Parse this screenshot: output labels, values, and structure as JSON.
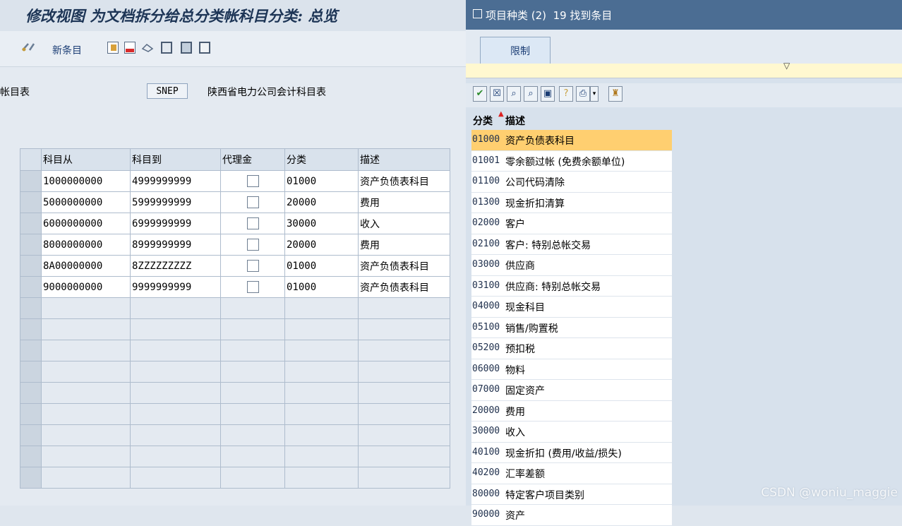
{
  "left": {
    "title": "修改视图 为文档拆分给总分类帐科目分类: 总览",
    "toolbar": {
      "new_entries": "新条目"
    },
    "field": {
      "label": "帐目表",
      "value": "SNEP",
      "description": "陕西省电力公司会计科目表"
    },
    "table": {
      "headers": [
        "科目从",
        "科目到",
        "代理金",
        "分类",
        "描述"
      ],
      "rows": [
        [
          "1000000000",
          "4999999999",
          false,
          "01000",
          "资产负债表科目"
        ],
        [
          "5000000000",
          "5999999999",
          false,
          "20000",
          "费用"
        ],
        [
          "6000000000",
          "6999999999",
          false,
          "30000",
          "收入"
        ],
        [
          "8000000000",
          "8999999999",
          false,
          "20000",
          "费用"
        ],
        [
          "8A00000000",
          "8ZZZZZZZZZ",
          false,
          "01000",
          "资产负债表科目"
        ],
        [
          "9000000000",
          "9999999999",
          false,
          "01000",
          "资产负债表科目"
        ]
      ]
    }
  },
  "right": {
    "title": "项目种类 (2)",
    "count_text": "19 找到条目",
    "tab": "限制",
    "list_headers": {
      "code": "分类",
      "desc": "描述"
    },
    "items": [
      {
        "code": "01000",
        "desc": "资产负债表科目"
      },
      {
        "code": "01001",
        "desc": "零余额过帐 (免费余额单位)"
      },
      {
        "code": "01100",
        "desc": "公司代码清除"
      },
      {
        "code": "01300",
        "desc": "现金折扣清算"
      },
      {
        "code": "02000",
        "desc": "客户"
      },
      {
        "code": "02100",
        "desc": "客户: 特别总帐交易"
      },
      {
        "code": "03000",
        "desc": "供应商"
      },
      {
        "code": "03100",
        "desc": "供应商: 特别总帐交易"
      },
      {
        "code": "04000",
        "desc": "现金科目"
      },
      {
        "code": "05100",
        "desc": "销售/购置税"
      },
      {
        "code": "05200",
        "desc": "预扣税"
      },
      {
        "code": "06000",
        "desc": "物料"
      },
      {
        "code": "07000",
        "desc": "固定资产"
      },
      {
        "code": "20000",
        "desc": "费用"
      },
      {
        "code": "30000",
        "desc": "收入"
      },
      {
        "code": "40100",
        "desc": "现金折扣 (费用/收益/损失)"
      },
      {
        "code": "40200",
        "desc": "汇率差额"
      },
      {
        "code": "80000",
        "desc": "特定客户项目类别"
      },
      {
        "code": "90000",
        "desc": "资产"
      }
    ]
  },
  "watermark": "CSDN @woniu_maggie",
  "colors": {
    "title_bar": "#4b6d93",
    "highlight_row": "#ffcf70",
    "accent_text": "#1a3c74"
  }
}
